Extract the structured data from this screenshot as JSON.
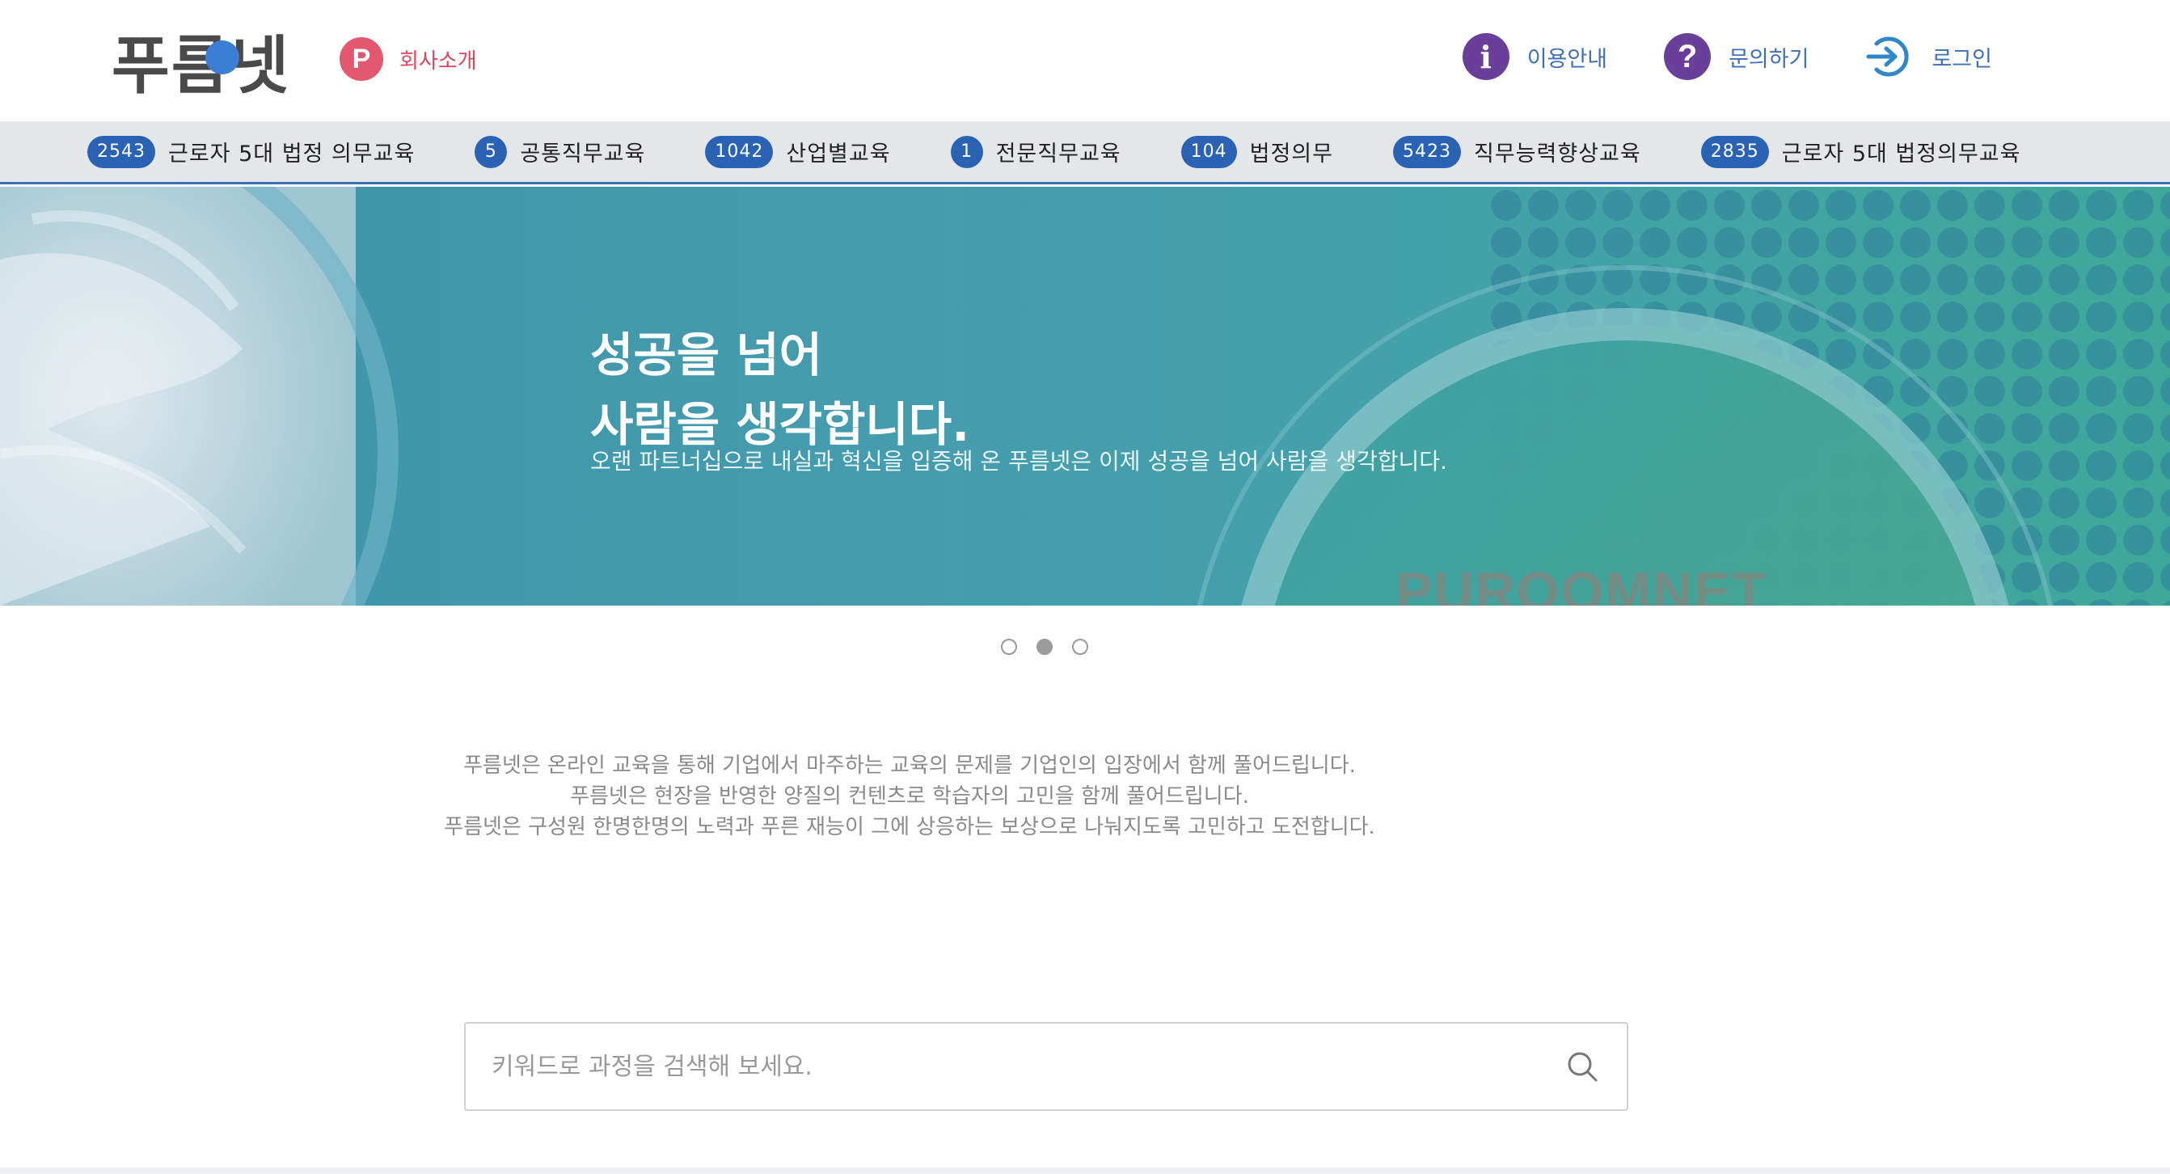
{
  "header": {
    "logo_text": "푸름넷",
    "company_badge": "P",
    "company_label": "회사소개",
    "links": [
      {
        "label": "이용안내",
        "icon": "info-icon"
      },
      {
        "label": "문의하기",
        "icon": "question-icon"
      },
      {
        "label": "로그인",
        "icon": "login-icon"
      }
    ],
    "info_glyph": "i",
    "question_glyph": "?"
  },
  "categories": [
    {
      "count": "2543",
      "label": "근로자 5대 법정 의무교육"
    },
    {
      "count": "5",
      "label": "공통직무교육"
    },
    {
      "count": "1042",
      "label": "산업별교육"
    },
    {
      "count": "1",
      "label": "전문직무교육"
    },
    {
      "count": "104",
      "label": "법정의무"
    },
    {
      "count": "5423",
      "label": "직무능력향상교육"
    },
    {
      "count": "2835",
      "label": "근로자 5대 법정의무교육"
    }
  ],
  "hero": {
    "line1": "성공을 넘어",
    "line2": "사람을 생각합니다.",
    "subtitle": "오랜 파트너십으로 내실과 혁신을 입증해 온 푸름넷은 이제 성공을 넘어 사람을 생각합니다.",
    "watermark": "PUROOMNET"
  },
  "slider": {
    "count": 3,
    "active_index": 1
  },
  "intro": {
    "lines": [
      "푸름넷은 온라인 교육을 통해 기업에서 마주하는 교육의 문제를 기업인의 입장에서 함께 풀어드립니다.",
      "푸름넷은 현장을 반영한 양질의 컨텐츠로 학습자의 고민을 함께 풀어드립니다.",
      "푸름넷은 구성원 한명한명의 노력과 푸른 재능이 그에 상응하는 보상으로 나눠지도록 고민하고 도전합니다."
    ]
  },
  "search": {
    "placeholder": "키워드로 과정을 검색해 보세요.",
    "value": "",
    "icon": "search-icon"
  },
  "colors": {
    "brand_blue": "#2a63b3",
    "accent_pink": "#e2596f",
    "purple": "#6a3f9a",
    "hero_teal": "#459cae"
  }
}
